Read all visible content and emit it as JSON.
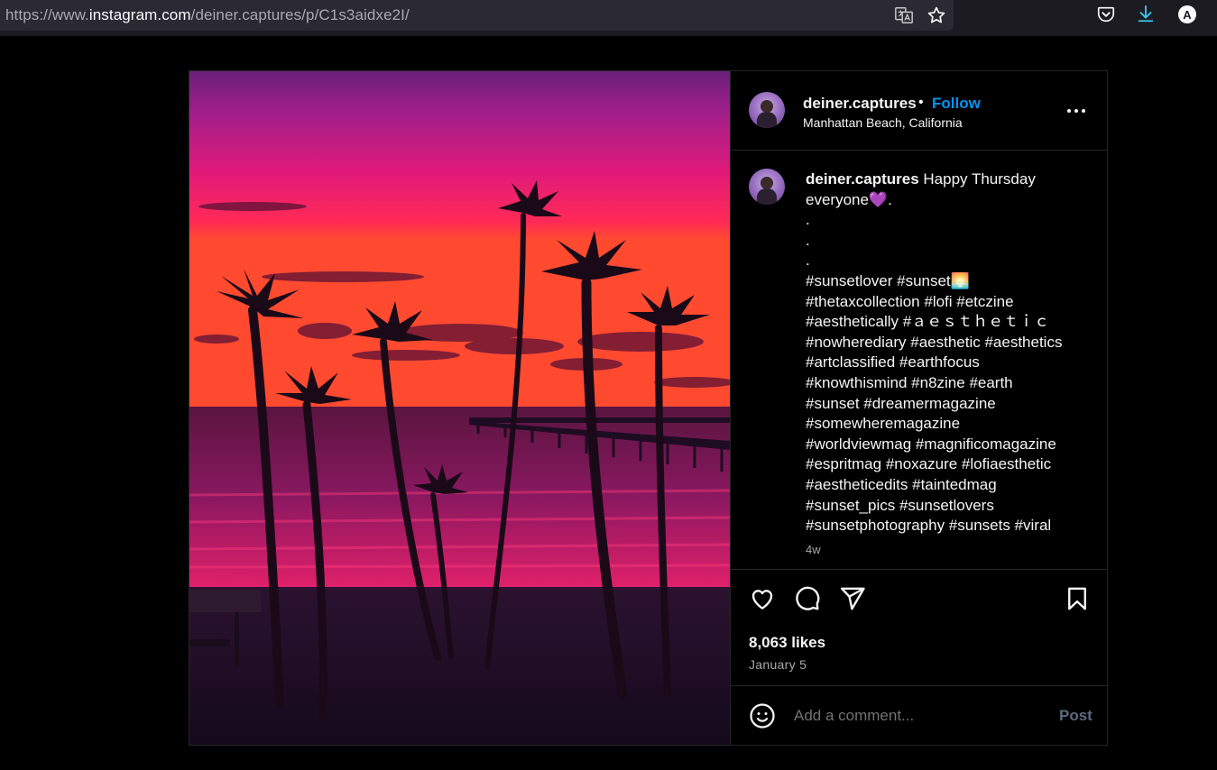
{
  "browser": {
    "url_prefix": "https://www.",
    "url_host": "instagram.com",
    "url_path": "/deiner.captures/p/C1s3aidxe2I/",
    "icons": [
      "translate-icon",
      "bookmark-star-icon",
      "pocket-icon",
      "download-icon",
      "account-icon"
    ],
    "account_initial": "A"
  },
  "post": {
    "username": "deiner.captures",
    "dot": "•",
    "follow_label": "Follow",
    "location": "Manhattan Beach, California",
    "caption_username": "deiner.captures",
    "caption_body": " Happy Thursday everyone💜.\n.\n.\n.\n#sunsetlover #sunset🌅\n#thetaxcollection #lofi #etczine\n#aesthetically #ａｅｓｔｈｅｔｉｃ\n#nowherediary #aesthetic #aesthetics\n#artclassified #earthfocus\n#knowthismind #n8zine #earth\n#sunset #dreamermagazine\n#somewheremagazine\n#worldviewmag #magnificomagazine\n#espritmag #noxazure #lofiaesthetic\n#aestheticedits #taintedmag\n#sunset_pics #sunsetlovers\n#sunsetphotography #sunsets #viral",
    "caption_time": "4w",
    "likes": "8,063 likes",
    "date": "January 5",
    "comment_placeholder": "Add a comment...",
    "post_label": "Post"
  },
  "colors": {
    "accent": "#0095f6",
    "background": "#000000",
    "border": "#262626"
  }
}
